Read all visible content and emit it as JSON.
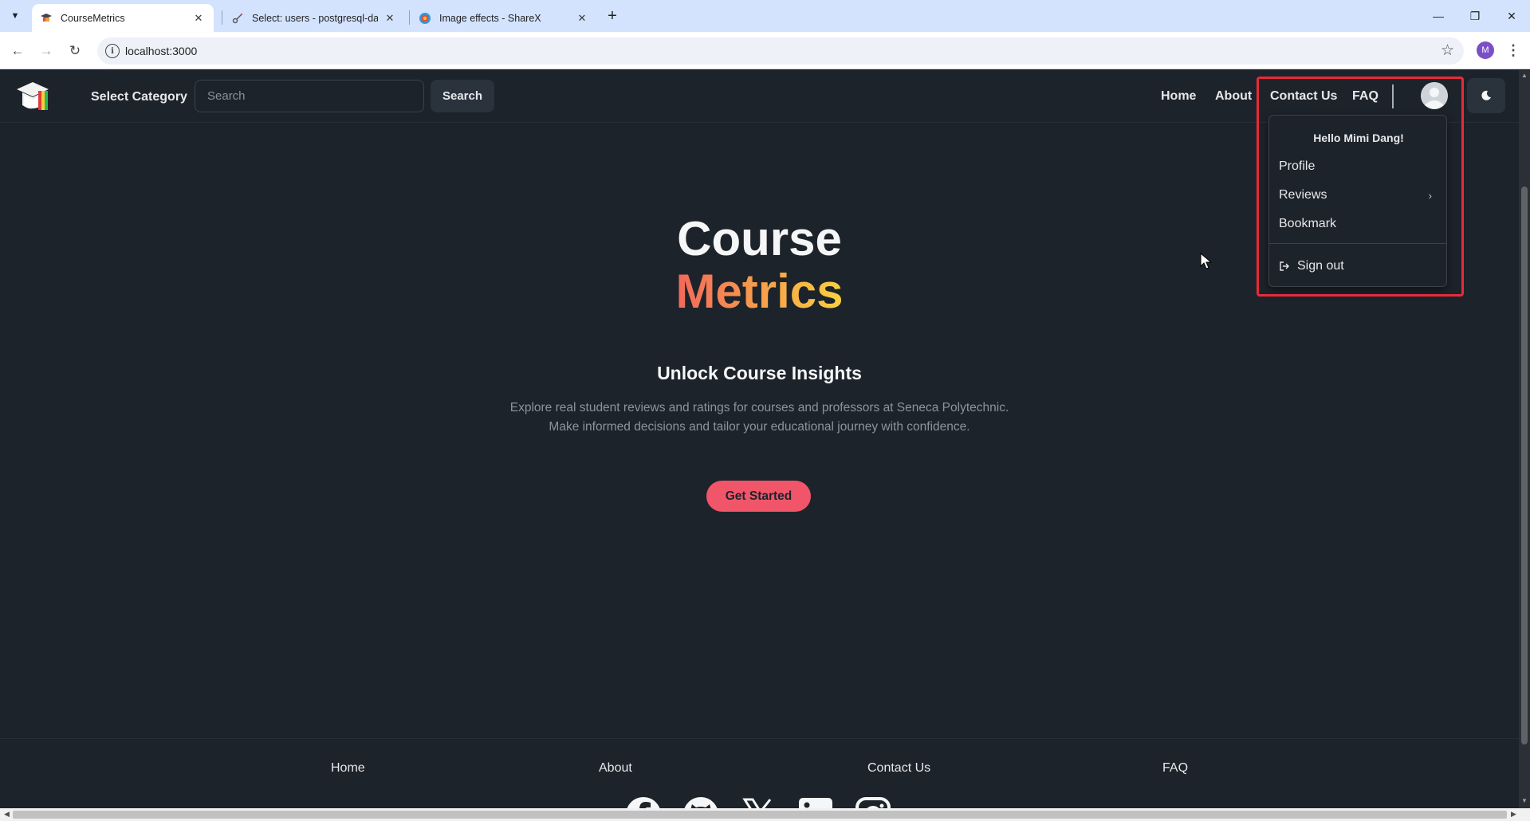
{
  "browser": {
    "tabs": [
      {
        "title": "CourseMetrics",
        "active": true
      },
      {
        "title": "Select: users - postgresql-datab",
        "active": false
      },
      {
        "title": "Image effects - ShareX",
        "active": false
      }
    ],
    "url": "localhost:3000",
    "profile_initial": "M"
  },
  "navbar": {
    "category_label": "Select Category",
    "search_placeholder": "Search",
    "search_button": "Search",
    "links": [
      "Home",
      "About",
      "Contact Us",
      "FAQ"
    ]
  },
  "user_menu": {
    "greeting": "Hello Mimi Dang!",
    "items": [
      "Profile",
      "Reviews",
      "Bookmark"
    ],
    "sign_out": "Sign out"
  },
  "hero": {
    "title_line1": "Course",
    "title_line2": "Metrics",
    "subtitle": "Unlock Course Insights",
    "description_line1": "Explore real student reviews and ratings for courses and professors at Seneca Polytechnic.",
    "description_line2": "Make informed decisions and tailor your educational journey with confidence.",
    "cta_label": "Get Started"
  },
  "footer": {
    "links": [
      "Home",
      "About",
      "Contact Us",
      "FAQ"
    ],
    "social_icons": [
      "facebook-icon",
      "github-icon",
      "x-icon",
      "linkedin-icon",
      "instagram-icon"
    ]
  },
  "colors": {
    "page_bg": "#1d232a",
    "accent_pink": "#f0556a",
    "gradient_start": "#f2675c",
    "gradient_end": "#f9d23f",
    "highlight_red": "#e52b3b"
  }
}
